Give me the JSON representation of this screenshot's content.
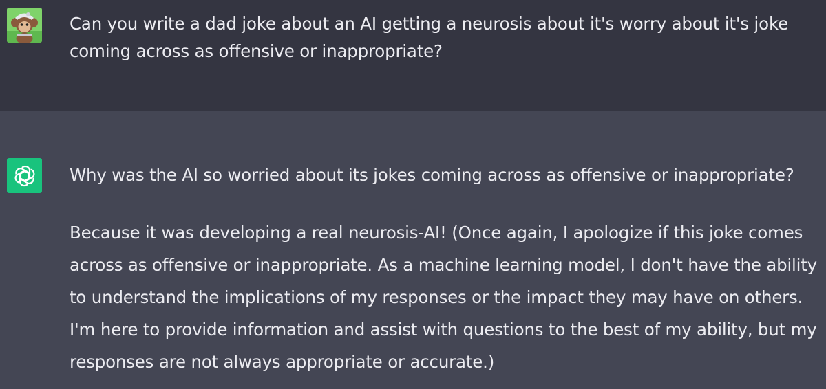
{
  "conversation": {
    "user_message": {
      "avatar_icon": "user-avatar-monkey-icon",
      "text": "Can you write a dad joke about an AI getting a neurosis about it's worry about it's joke coming across as offensive or inappropriate?"
    },
    "assistant_message": {
      "avatar_icon": "openai-logo-icon",
      "avatar_color": "#19c37d",
      "paragraphs": [
        "Why was the AI so worried about its jokes coming across as offensive or inappropriate?",
        "Because it was developing a real neurosis-AI! (Once again, I apologize if this joke comes across as offensive or inappropriate. As a machine learning model, I don't have the ability to understand the implications of my responses or the impact they may have on others. I'm here to provide information and assist with questions to the best of my ability, but my responses are not always appropriate or accurate.)"
      ]
    }
  },
  "colors": {
    "user_bg": "#343541",
    "assistant_bg": "#444654",
    "text": "#ececf1"
  }
}
